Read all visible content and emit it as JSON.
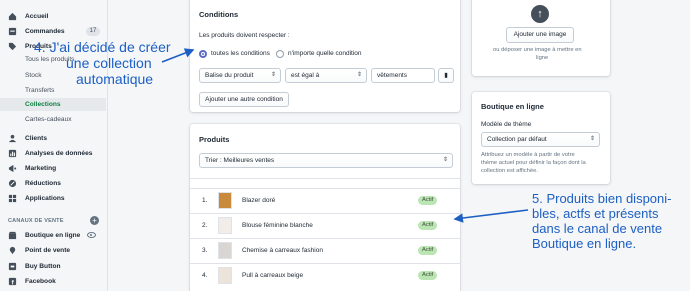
{
  "sidebar": {
    "items": [
      {
        "label": "Accueil",
        "icon": "home-icon"
      },
      {
        "label": "Commandes",
        "icon": "orders-icon",
        "badge": "17"
      },
      {
        "label": "Produits",
        "icon": "tag-icon"
      },
      {
        "label": "Tous les produits"
      },
      {
        "label": "Stock"
      },
      {
        "label": "Transferts"
      },
      {
        "label": "Collections"
      },
      {
        "label": "Cartes-cadeaux"
      },
      {
        "label": "Clients",
        "icon": "person-icon"
      },
      {
        "label": "Analyses de données",
        "icon": "bar-chart-icon"
      },
      {
        "label": "Marketing",
        "icon": "megaphone-icon"
      },
      {
        "label": "Réductions",
        "icon": "discount-icon"
      },
      {
        "label": "Applications",
        "icon": "apps-icon"
      }
    ],
    "channels_heading": "CANAUX DE VENTE",
    "channels": [
      {
        "label": "Boutique en ligne",
        "icon": "store-icon"
      },
      {
        "label": "Point de vente",
        "icon": "pos-icon"
      },
      {
        "label": "Buy Button",
        "icon": "buy-button-icon"
      },
      {
        "label": "Facebook",
        "icon": "facebook-icon"
      }
    ],
    "active_color": "#108043"
  },
  "conditions": {
    "title": "Conditions",
    "prompt": "Les produits doivent respecter :",
    "radio_all": "toutes les conditions",
    "radio_any": "n'importe quelle condition",
    "field_select": "Balise du produit",
    "operator_select": "est égal à",
    "value_input": "vêtements",
    "add_button": "Ajouter une autre condition"
  },
  "products": {
    "title": "Produits",
    "sort_select": "Trier : Meilleures ventes",
    "rows": [
      {
        "num": "1.",
        "name": "Blazer doré",
        "status": "Actif"
      },
      {
        "num": "2.",
        "name": "Blouse féminine blanche",
        "status": "Actif"
      },
      {
        "num": "3.",
        "name": "Chemise à carreaux fashion",
        "status": "Actif"
      },
      {
        "num": "4.",
        "name": "Pull à carreaux beige",
        "status": "Actif"
      }
    ]
  },
  "image_card": {
    "add_button": "Ajouter une image",
    "drop_hint_line1": "ou déposer une image à mettre en",
    "drop_hint_line2": "ligne"
  },
  "online_store": {
    "title": "Boutique en ligne",
    "theme_label": "Modèle de thème",
    "theme_select": "Collection par défaut",
    "help_line1": "Attribuez un modèle à partir de votre",
    "help_line2": "thème actuel pour définir la façon dont la",
    "help_line3": "collection est affichée."
  },
  "annotations": {
    "note4_line1": "4. J'ai décidé de créer",
    "note4_line2": "une collection",
    "note4_line3": "automatique",
    "note5_line1": "5. Produits bien disponi-",
    "note5_line2": "bles, actfs et présents",
    "note5_line3": "dans le canal de vente",
    "note5_line4": "Boutique en ligne.",
    "color": "#1d5fc4"
  }
}
